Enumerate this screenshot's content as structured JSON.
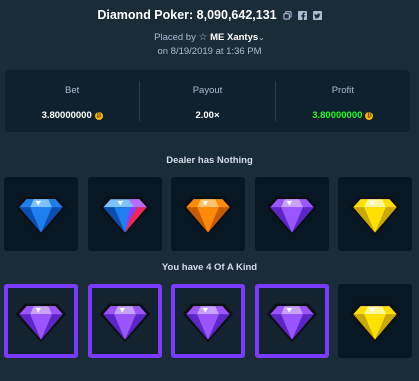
{
  "header": {
    "title": "Diamond Poker: 8,090,642,131",
    "copy_icon": "copy-icon",
    "facebook_icon": "facebook-icon",
    "twitter_icon": "twitter-icon"
  },
  "bet_info": {
    "placed_by_label": "Placed by",
    "username": "ME Xantys",
    "date": "on 8/19/2019 at 1:36 PM"
  },
  "stats": {
    "bet_label": "Bet",
    "bet_value": "3.80000000",
    "payout_label": "Payout",
    "payout_value": "2.00×",
    "profit_label": "Profit",
    "profit_value": "3.80000000",
    "currency_icon": "btc-coin-icon"
  },
  "dealer": {
    "label": "Dealer has Nothing",
    "gems": [
      "blue",
      "blue-red",
      "orange",
      "purple",
      "yellow"
    ]
  },
  "player": {
    "label": "You have 4 Of A Kind",
    "gems": [
      "purple",
      "purple",
      "purple",
      "purple",
      "yellow"
    ],
    "highlighted": [
      true,
      true,
      true,
      true,
      false
    ]
  },
  "colors": {
    "background": "#1a2c38",
    "panel": "#0f212e",
    "card": "#071824",
    "win_border": "#7b3bff",
    "profit_green": "#1fff20",
    "blue_gem": "#1e7ff0",
    "red_gem": "#f02850",
    "orange_gem": "#ff8a0a",
    "purple_gem": "#9b55ff",
    "yellow_gem": "#ffe000"
  }
}
